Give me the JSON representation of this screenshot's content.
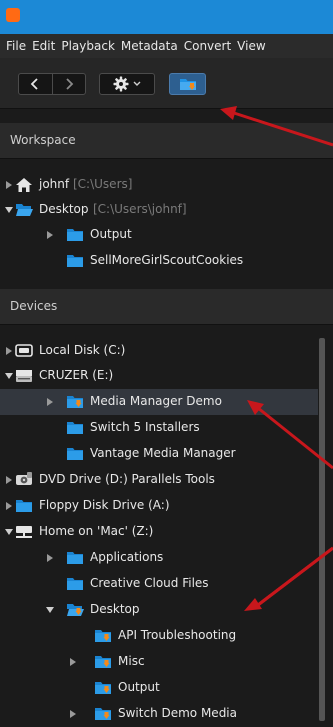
{
  "app": {
    "icon_letter": "",
    "title_bar_color": "#1c89d6"
  },
  "menu": [
    "File",
    "Edit",
    "Playback",
    "Metadata",
    "Convert",
    "View"
  ],
  "toolbar": {
    "back_icon": "chevron-left",
    "forward_icon": "chevron-right",
    "settings_icon": "gear",
    "settings_caret_icon": "chevron-down",
    "folder_icon": "folder-download",
    "folder_button_color": "#2d5f90"
  },
  "workspace": {
    "title": "Workspace",
    "items": [
      {
        "label": "johnf",
        "sub": "[C:\\Users]",
        "icon": "home-icon",
        "expander": "collapsed"
      },
      {
        "label": "Desktop",
        "sub": "[C:\\Users\\johnf]",
        "icon": "folder-open-icon",
        "expander": "expanded"
      },
      {
        "label": "Output",
        "sub": "",
        "icon": "folder-icon",
        "expander": "collapsed"
      },
      {
        "label": "SellMoreGirlScoutCookies",
        "sub": "",
        "icon": "folder-icon",
        "expander": "none"
      }
    ]
  },
  "devices": {
    "title": "Devices",
    "items": [
      {
        "label": "Local Disk (C:)",
        "icon": "hard-drive-icon",
        "expander": "collapsed",
        "selected": false
      },
      {
        "label": "CRUZER (E:)",
        "icon": "removable-drive-icon",
        "expander": "expanded",
        "selected": false
      },
      {
        "label": "Media Manager Demo",
        "icon": "watch-folder-icon",
        "expander": "collapsed",
        "selected": true
      },
      {
        "label": "Switch 5 Installers",
        "icon": "folder-icon",
        "expander": "none",
        "selected": false
      },
      {
        "label": "Vantage Media Manager",
        "icon": "folder-icon",
        "expander": "none",
        "selected": false
      },
      {
        "label": "DVD Drive (D:) Parallels Tools",
        "icon": "dvd-drive-icon",
        "expander": "collapsed",
        "selected": false
      },
      {
        "label": "Floppy Disk Drive (A:)",
        "icon": "folder-icon",
        "expander": "collapsed",
        "selected": false
      },
      {
        "label": "Home on 'Mac' (Z:)",
        "icon": "network-drive-icon",
        "expander": "expanded",
        "selected": false
      },
      {
        "label": "Applications",
        "icon": "folder-icon",
        "expander": "collapsed",
        "selected": false
      },
      {
        "label": "Creative Cloud Files",
        "icon": "folder-icon",
        "expander": "none",
        "selected": false
      },
      {
        "label": "Desktop",
        "icon": "watch-folder-open-icon",
        "expander": "expanded",
        "selected": false
      },
      {
        "label": "API Troubleshooting",
        "icon": "watch-folder-icon",
        "expander": "none",
        "selected": false
      },
      {
        "label": "Misc",
        "icon": "watch-folder-icon",
        "expander": "collapsed",
        "selected": false
      },
      {
        "label": "Output",
        "icon": "watch-folder-icon",
        "expander": "none",
        "selected": false
      },
      {
        "label": "Switch Demo Media",
        "icon": "watch-folder-icon",
        "expander": "collapsed",
        "selected": false
      }
    ]
  },
  "annotations": {
    "arrow_color": "#c8171c",
    "arrows": 4
  },
  "colors": {
    "folder": "#1f93e6",
    "folder_badge": "#f28a1b",
    "selection": "#33373e"
  }
}
